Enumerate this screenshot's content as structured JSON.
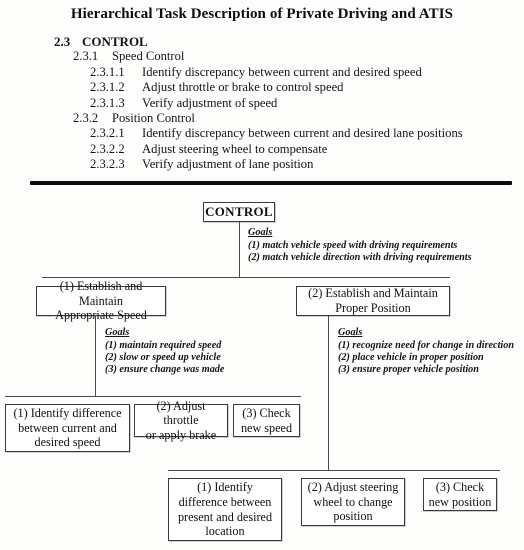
{
  "document": {
    "title": "Hierarchical Task Description of Private Driving and ATIS"
  },
  "outline": {
    "items": [
      {
        "number": "2.3",
        "text": "CONTROL",
        "level": 1
      },
      {
        "number": "2.3.1",
        "text": "Speed Control",
        "level": 2
      },
      {
        "number": "2.3.1.1",
        "text": "Identify discrepancy between current and desired speed",
        "level": 3
      },
      {
        "number": "2.3.1.2",
        "text": "Adjust throttle or brake to control speed",
        "level": 3
      },
      {
        "number": "2.3.1.3",
        "text": "Verify adjustment of speed",
        "level": 3
      },
      {
        "number": "2.3.2",
        "text": "Position Control",
        "level": 2
      },
      {
        "number": "2.3.2.1",
        "text": "Identify discrepancy between current and desired lane positions",
        "level": 3
      },
      {
        "number": "2.3.2.2",
        "text": "Adjust steering wheel to compensate",
        "level": 3
      },
      {
        "number": "2.3.2.3",
        "text": "Verify adjustment of lane position",
        "level": 3
      }
    ]
  },
  "diagram": {
    "root": {
      "label": "CONTROL",
      "goals_heading": "Goals",
      "goals": [
        "(1) match vehicle speed with driving requirements",
        "(2) match vehicle direction with driving requirements"
      ]
    },
    "branch_left": {
      "label_line1": "(1) Establish and Maintain",
      "label_line2": "Appropriate Speed",
      "goals_heading": "Goals",
      "goals": [
        "(1) maintain required speed",
        "(2) slow or speed up vehicle",
        "(3) ensure change was made"
      ],
      "children": [
        {
          "line1": "(1) Identify difference",
          "line2": "between current and",
          "line3": "desired speed"
        },
        {
          "line1": "(2) Adjust throttle",
          "line2": "or apply brake",
          "line3": ""
        },
        {
          "line1": "(3) Check",
          "line2": "new speed",
          "line3": ""
        }
      ]
    },
    "branch_right": {
      "label_line1": "(2) Establish and Maintain",
      "label_line2": "Proper Position",
      "goals_heading": "Goals",
      "goals": [
        "(1) recognize need for change in direction",
        "(2) place vehicle in proper position",
        "(3) ensure proper vehicle position"
      ],
      "children": [
        {
          "line1": "(1) Identify",
          "line2": "difference between",
          "line3": "present and desired",
          "line4": "location"
        },
        {
          "line1": "(2) Adjust steering",
          "line2": "wheel to change",
          "line3": "position",
          "line4": ""
        },
        {
          "line1": "(3) Check",
          "line2": "new position",
          "line3": "",
          "line4": ""
        }
      ]
    }
  },
  "colors": {
    "ink": "#111111",
    "rule": "#0a0a0a",
    "box_border": "#3a3a3a",
    "connector": "#4a4a4a",
    "page_background": "#fdfdfc"
  }
}
